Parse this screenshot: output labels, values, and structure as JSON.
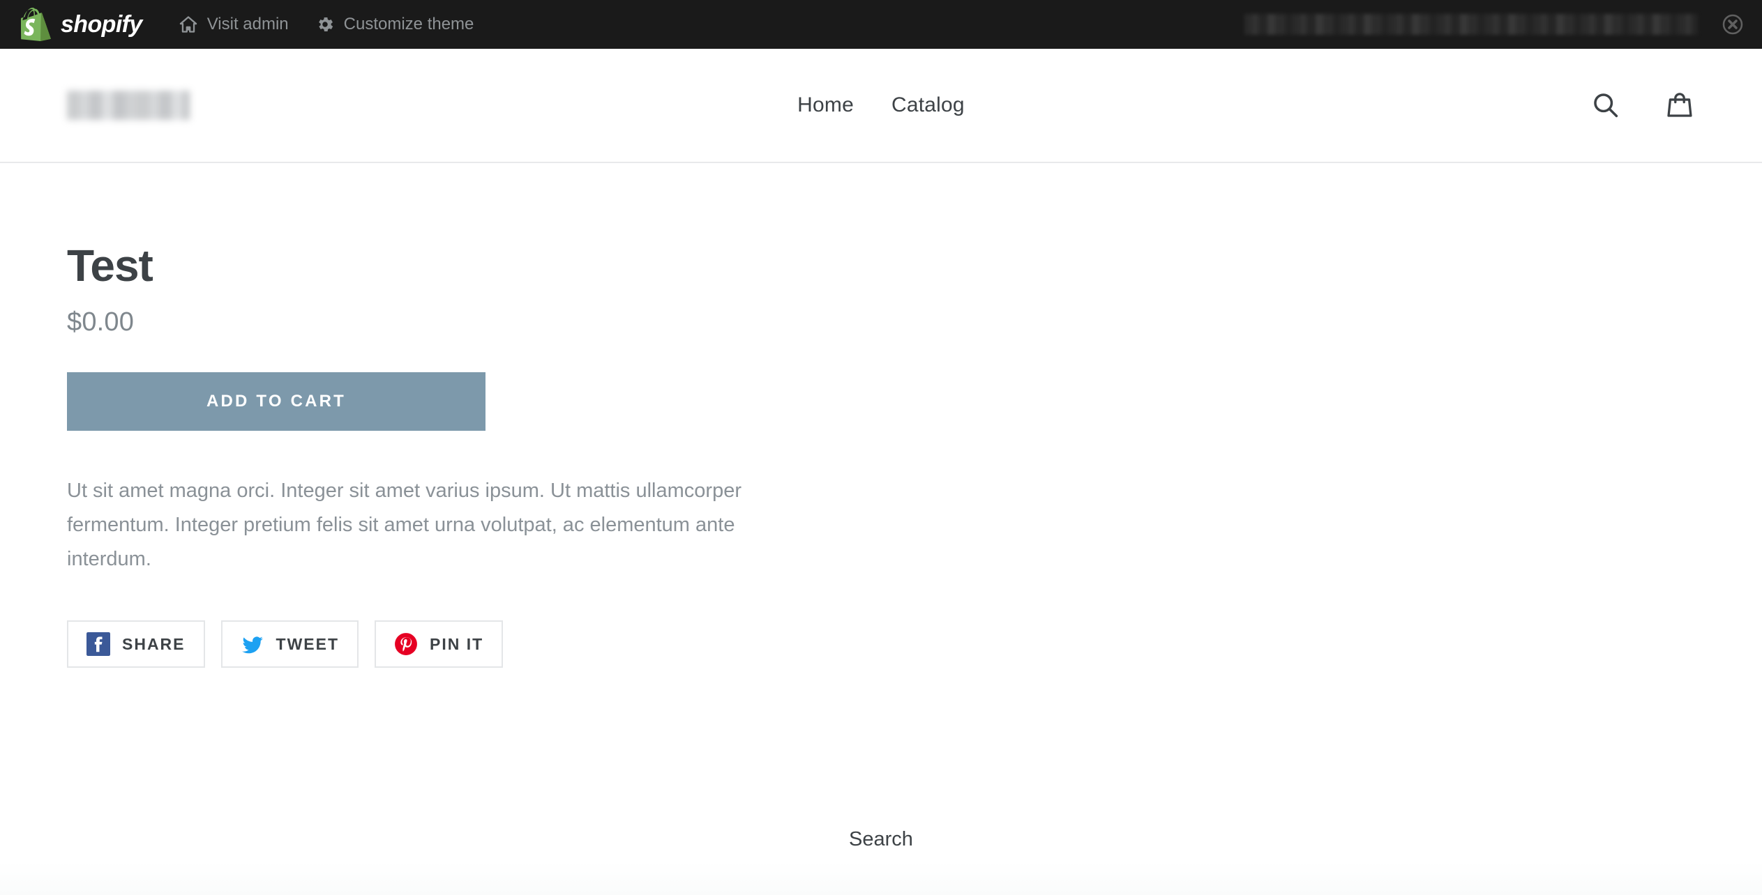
{
  "preview_bar": {
    "brand": "shopify",
    "brand_icon": "shopify-bag-logo",
    "links": [
      {
        "label": "Visit admin",
        "icon": "home-icon"
      },
      {
        "label": "Customize theme",
        "icon": "gear-icon"
      }
    ],
    "redacted_note": "",
    "close_icon": "close-circle-icon",
    "background_color": "#1a1a1a",
    "text_color": "#8f9396"
  },
  "header": {
    "store_logo_alt": "",
    "nav": [
      {
        "label": "Home"
      },
      {
        "label": "Catalog"
      }
    ],
    "icons": [
      {
        "name": "search-icon"
      },
      {
        "name": "cart-icon"
      }
    ]
  },
  "product": {
    "title": "Test",
    "price": "$0.00",
    "add_to_cart_label": "ADD TO CART",
    "add_to_cart_color": "#7d99ab",
    "description": "Ut sit amet magna orci. Integer sit amet varius ipsum. Ut mattis ullamcorper fermentum. Integer pretium felis sit amet urna volutpat, ac elementum ante interdum.",
    "share_buttons": [
      {
        "label": "SHARE",
        "icon": "facebook-icon",
        "color": "#3b5998"
      },
      {
        "label": "TWEET",
        "icon": "twitter-icon",
        "color": "#1da1f2"
      },
      {
        "label": "PIN IT",
        "icon": "pinterest-icon",
        "color": "#e60023"
      }
    ]
  },
  "footer": {
    "links": [
      {
        "label": "Search"
      }
    ]
  }
}
